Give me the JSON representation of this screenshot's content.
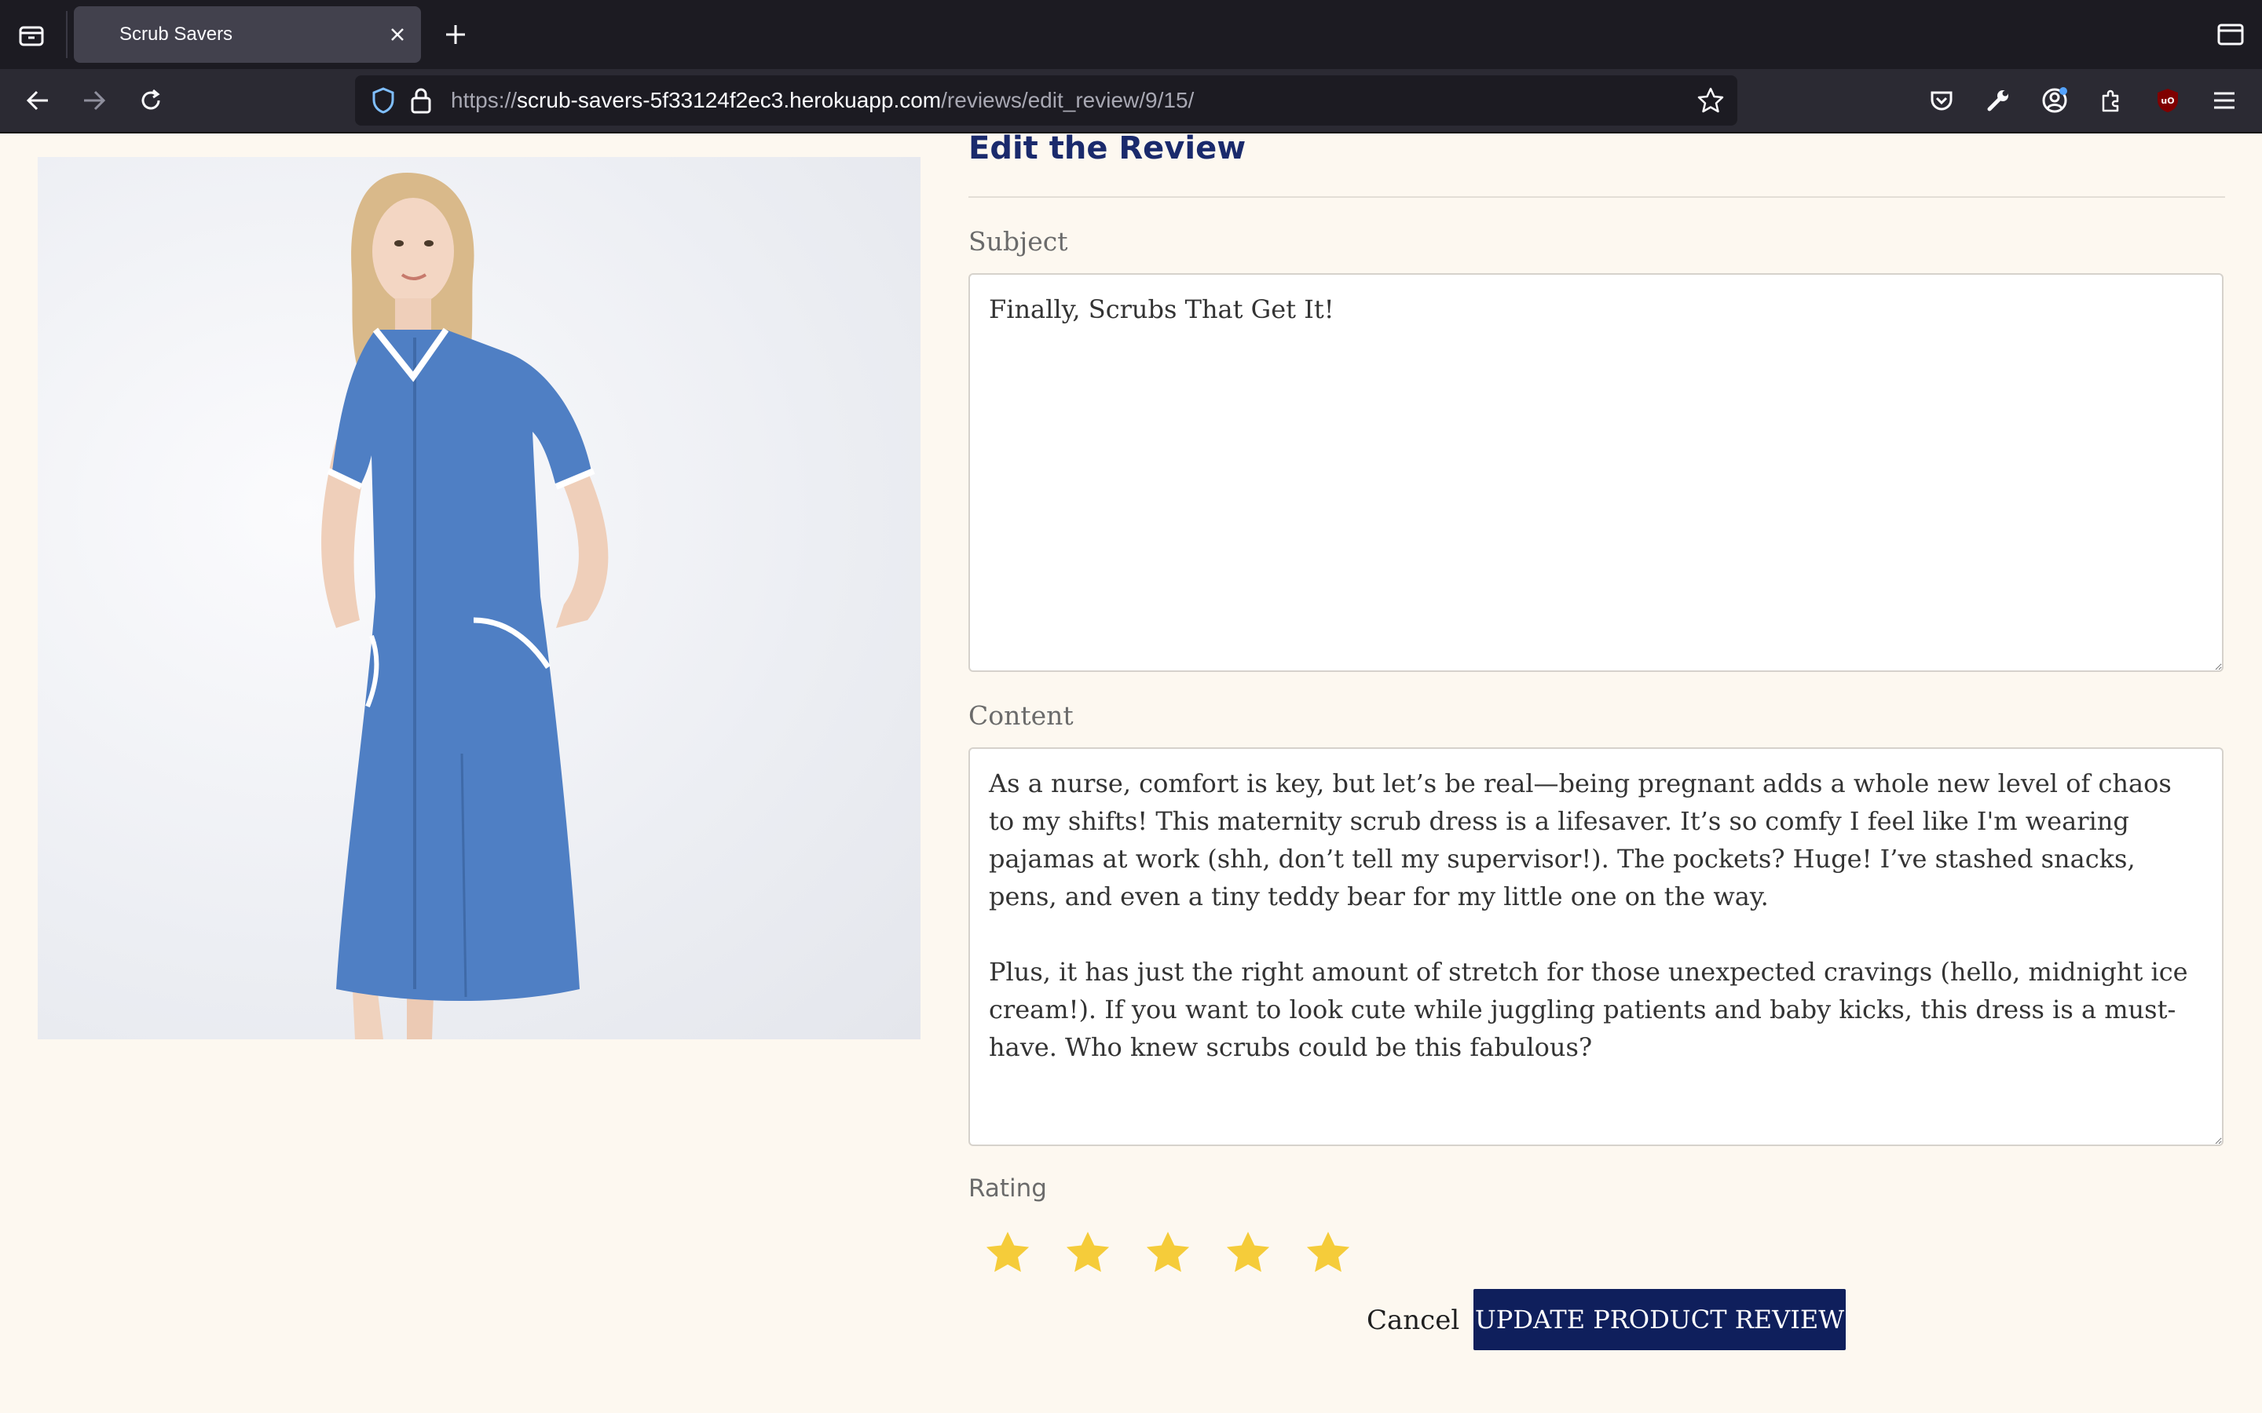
{
  "browser": {
    "tab_title": "Scrub Savers",
    "url_scheme": "https://",
    "url_host": "scrub-savers-5f33124f2ec3.herokuapp.com",
    "url_path": "/reviews/edit_review/9/15/"
  },
  "page": {
    "title": "Edit the Review",
    "product_image_alt": "Blue maternity scrub dress"
  },
  "form": {
    "subject_label": "Subject",
    "subject_value": "Finally, Scrubs That Get It!",
    "content_label": "Content",
    "content_value": "As a nurse, comfort is key, but let’s be real—being pregnant adds a whole new level of chaos to my shifts! This maternity scrub dress is a lifesaver. It’s so comfy I feel like I'm wearing pajamas at work (shh, don’t tell my supervisor!). The pockets? Huge! I’ve stashed snacks, pens, and even a tiny teddy bear for my little one on the way.\n\nPlus, it has just the right amount of stretch for those unexpected cravings (hello, midnight ice cream!). If you want to look cute while juggling patients and baby kicks, this dress is a must-have. Who knew scrubs could be this fabulous?",
    "rating_label": "Rating",
    "rating_value": 5,
    "rating_max": 5,
    "cancel_label": "Cancel",
    "submit_label": "UPDATE PRODUCT REVIEW"
  },
  "colors": {
    "page_background": "#fdf8f0",
    "title_color": "#1a2a6c",
    "button_background": "#0f1f5c",
    "star_color": "#f5cc3a"
  }
}
